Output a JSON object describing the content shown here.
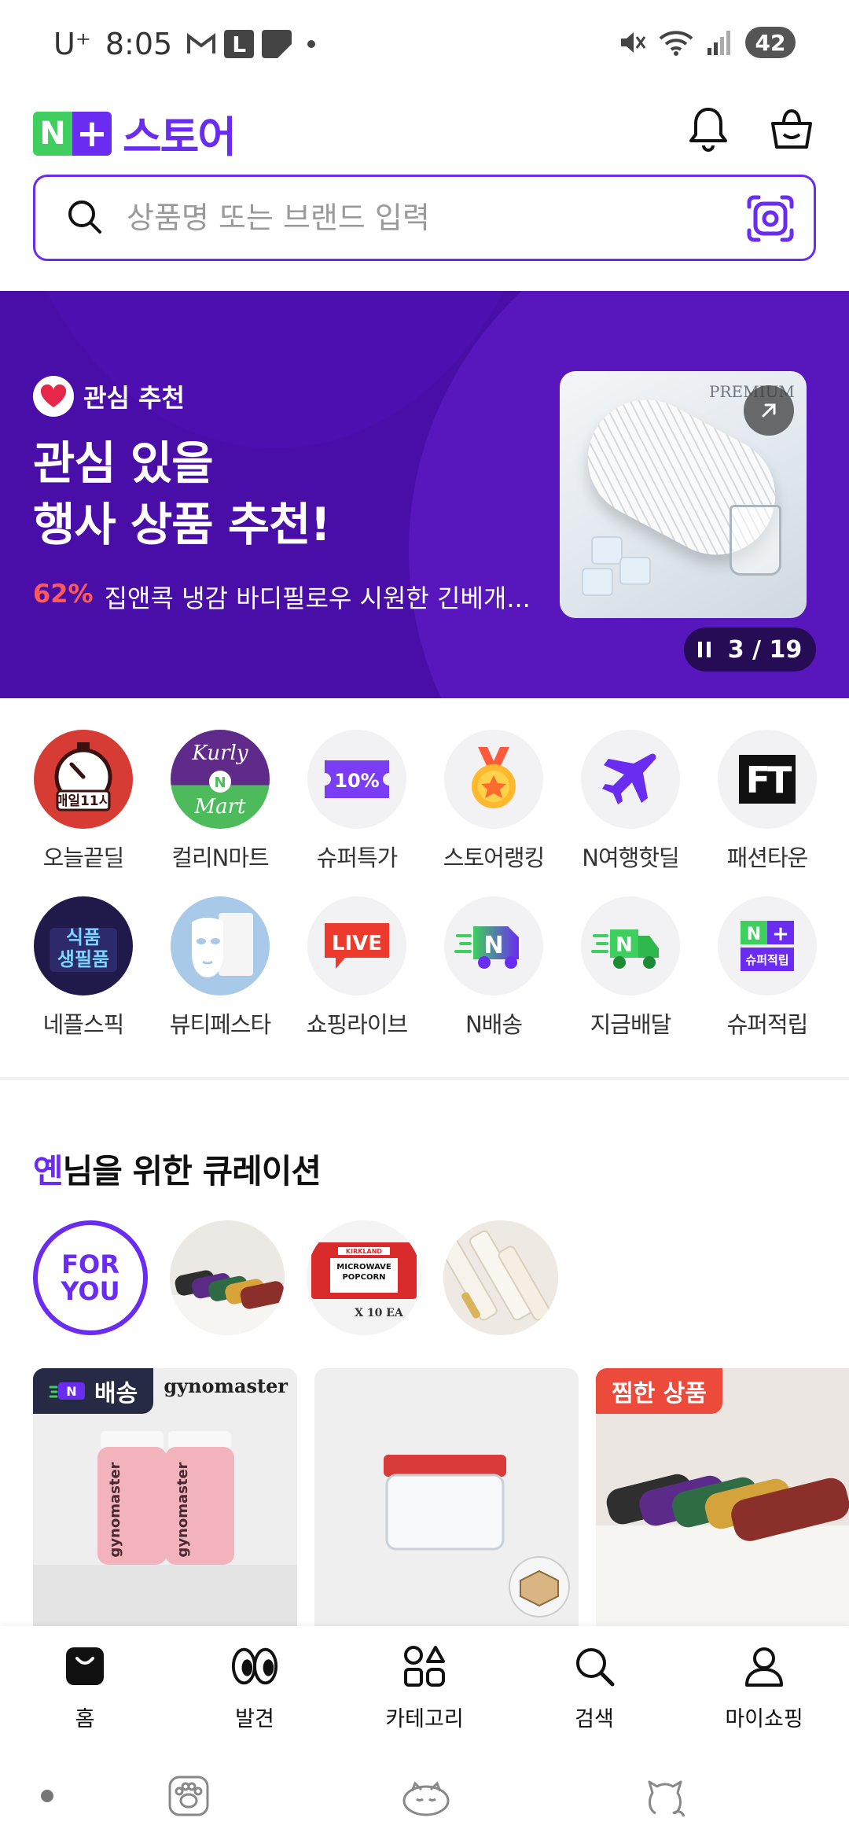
{
  "status_bar": {
    "carrier": "U⁺",
    "time": "8:05",
    "notif_l": "L",
    "battery": "42"
  },
  "header": {
    "logo_n": "N",
    "logo_plus": "+",
    "logo_text": "스토어"
  },
  "search": {
    "placeholder": "상품명 또는 브랜드 입력"
  },
  "banner": {
    "tag": "관심 추천",
    "title_line1": "관심 있을",
    "title_line2": "행사 상품 추천!",
    "discount": "62%",
    "product": "집앤콕 냉감 바디필로우 시원한 긴베개...",
    "image_text": "PREMIUM",
    "pager": "3 / 19"
  },
  "shortcuts": [
    {
      "label": "오늘끝딜",
      "icon": "alarm-clock-icon",
      "icon_text": "매일11시"
    },
    {
      "label": "컬리N마트",
      "icon": "kurly-mart-icon",
      "icon_text_top": "Kurly",
      "icon_text_mid": "N",
      "icon_text_bottom": "Mart"
    },
    {
      "label": "슈퍼특가",
      "icon": "coupon-icon",
      "icon_text": "10%"
    },
    {
      "label": "스토어랭킹",
      "icon": "medal-icon"
    },
    {
      "label": "N여행핫딜",
      "icon": "airplane-icon"
    },
    {
      "label": "패션타운",
      "icon": "fashion-town-icon",
      "icon_text": "FT"
    },
    {
      "label": "네플스픽",
      "icon": "food-essentials-icon",
      "icon_text_top": "식품",
      "icon_text_bottom": "생필품"
    },
    {
      "label": "뷰티페스타",
      "icon": "face-mask-icon"
    },
    {
      "label": "쇼핑라이브",
      "icon": "live-icon",
      "icon_text": "LIVE"
    },
    {
      "label": "N배송",
      "icon": "n-delivery-truck-icon",
      "icon_text": "N"
    },
    {
      "label": "지금배달",
      "icon": "now-delivery-truck-icon",
      "icon_text": "N"
    },
    {
      "label": "슈퍼적립",
      "icon": "super-points-icon",
      "icon_text_top": "N",
      "icon_text_plus": "+",
      "icon_text_bottom": "슈퍼적립"
    }
  ],
  "curation": {
    "name_highlight": "옌",
    "title_rest": "님을 위한 큐레이션",
    "for_you_line1": "FOR",
    "for_you_line2": "YOU",
    "popcorn_brand": "KIRKLAND",
    "popcorn_line1": "MICROWAVE",
    "popcorn_line2": "POPCORN",
    "popcorn_count": "X 10 EA"
  },
  "cards": [
    {
      "badge": "배송",
      "badge_n": "N",
      "brand": "gynomaster",
      "bottle_text": "gynomaster"
    },
    {
      "badge": ""
    },
    {
      "badge": "찜한 상품"
    }
  ],
  "bottom_nav": [
    {
      "label": "홈",
      "icon": "home-bag-icon"
    },
    {
      "label": "발견",
      "icon": "eyes-icon"
    },
    {
      "label": "카테고리",
      "icon": "category-icon"
    },
    {
      "label": "검색",
      "icon": "search-icon"
    },
    {
      "label": "마이쇼핑",
      "icon": "profile-icon"
    }
  ],
  "colors": {
    "brand_purple": "#6a2cf0",
    "brand_green": "#3ecf5e",
    "banner_bg": "#4a0ea8",
    "discount_red": "#ff5a5a"
  }
}
